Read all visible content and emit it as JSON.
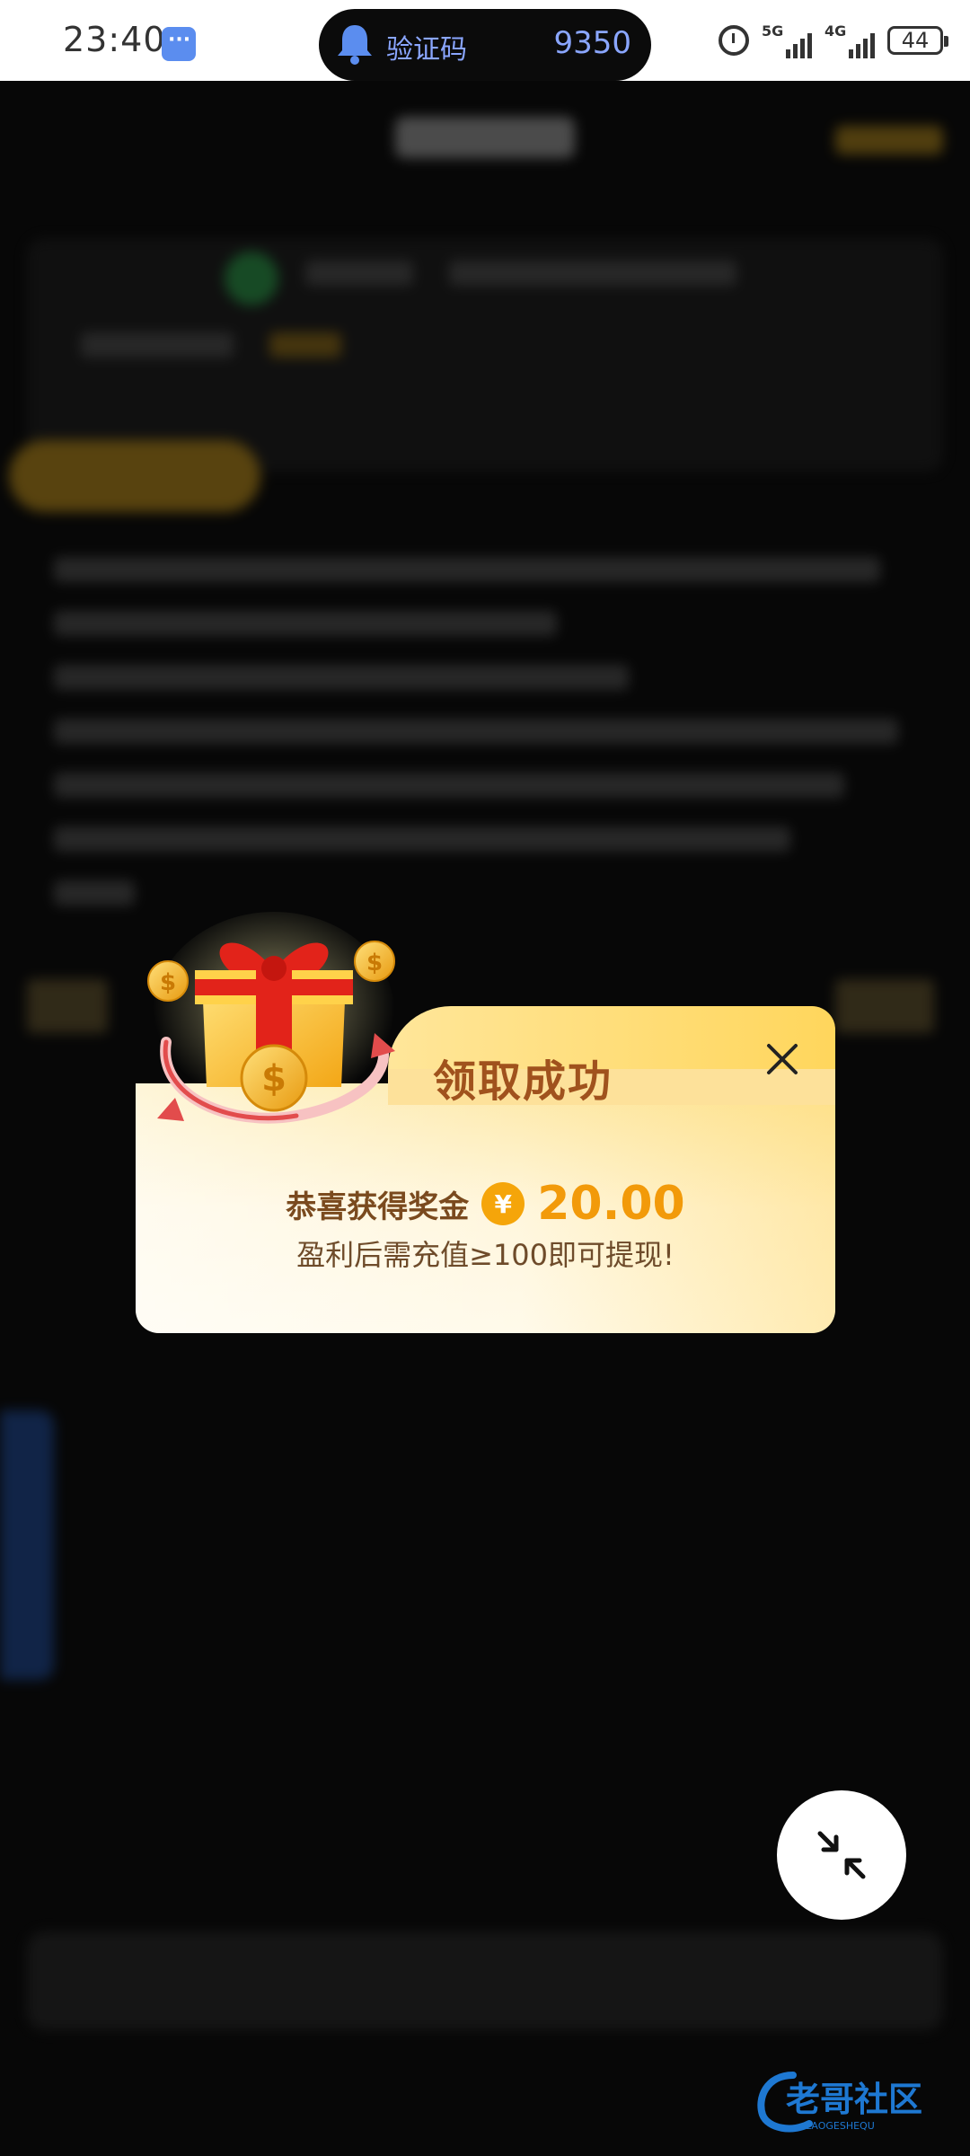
{
  "status_bar": {
    "time": "23:40",
    "notification_title": "验证码",
    "notification_code": "9350",
    "network_5g": "5G",
    "network_4g": "4G",
    "battery": "44"
  },
  "dialog": {
    "title": "领取成功",
    "reward_label": "恭喜获得奖金",
    "currency_symbol": "¥",
    "reward_amount": "20.00",
    "withdraw_hint": "盈利后需充值≥100即可提现!"
  },
  "watermark": {
    "text": "老哥社区",
    "subtext": "LAOGESHEQU"
  },
  "colors": {
    "dialog_title": "#a0521d",
    "reward_amount": "#f29a0a",
    "coin": "#f5a50a",
    "watermark": "#1e78d2"
  },
  "icons": {
    "close": "close-icon",
    "minimize": "minimize-arrows-icon",
    "gift": "gift-box-icon"
  }
}
